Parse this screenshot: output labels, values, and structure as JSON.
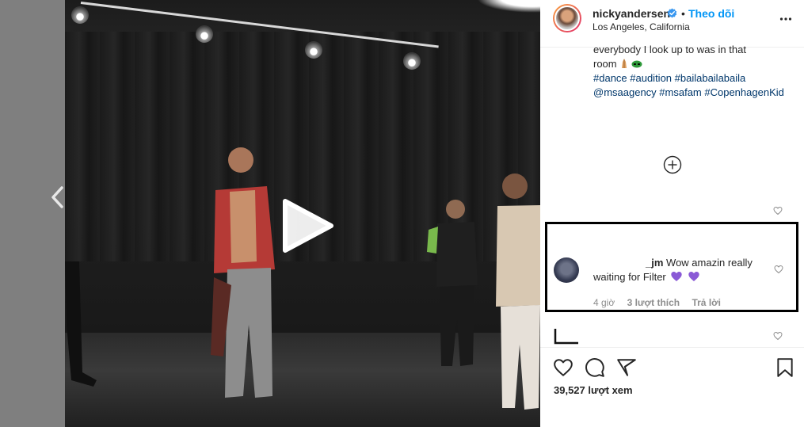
{
  "post": {
    "username": "nickyandersen",
    "separator": "•",
    "follow_label": "Theo dõi",
    "location": "Los Angeles, California"
  },
  "caption": {
    "line1": "everybody I look up to was in that",
    "line2": "room",
    "hashtags_line1": "#dance #audition #bailabailabaila",
    "mentions_line": "@msaagency #msafam",
    "hashtags_line2": "#CopenhagenKid"
  },
  "comment": {
    "username_suffix": "_jm",
    "text": "Wow amazin really waiting for Filter",
    "time": "4 giờ",
    "likes": "3 lượt thích",
    "reply": "Trả lời"
  },
  "stats": {
    "views": "39,527 lượt xem"
  },
  "icons": {
    "verified": "verified-badge-icon",
    "more": "more-options-icon",
    "load_more": "plus-circle-icon",
    "like": "heart-icon",
    "comment": "comment-icon",
    "share": "share-icon",
    "save": "bookmark-icon",
    "prev": "chevron-left-icon",
    "play": "play-icon"
  },
  "colors": {
    "link": "#0095f6",
    "hashtag": "#00376b",
    "text": "#262626",
    "meta": "#8e8e8e",
    "heart_emoji": "#8a5ad6",
    "highlight_box": "#000000"
  }
}
